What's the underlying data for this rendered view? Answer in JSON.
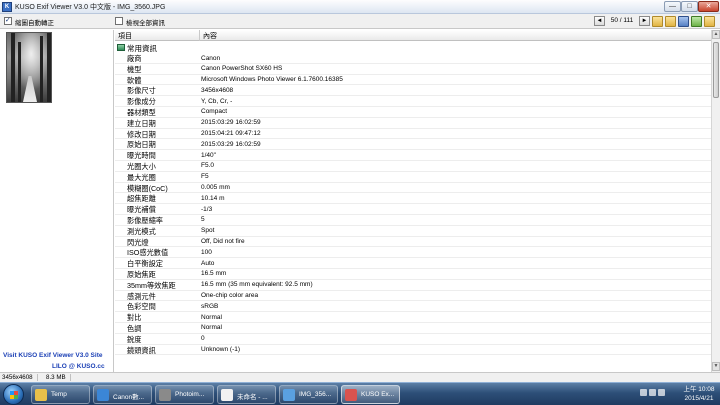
{
  "window": {
    "title": "KUSO Exif Viewer V3.0 中文版 - IMG_3560.JPG",
    "min_glyph": "—",
    "max_glyph": "□",
    "close_glyph": "✕"
  },
  "toolbar": {
    "auto_rotate_label": "縮圖自動轉正",
    "show_all_label": "檢視全部資訊",
    "prev_glyph": "◄",
    "next_glyph": "►",
    "page_count": "50 / 111"
  },
  "left": {
    "credit_line1": "Visit KUSO Exif Viewer V3.0 Site",
    "credit_line2": "LILO @ KUSO.cc"
  },
  "table": {
    "col_item": "項目",
    "col_content": "內容",
    "group_label": "常用資訊",
    "rows": [
      {
        "k": "廠商",
        "v": "Canon"
      },
      {
        "k": "機型",
        "v": "Canon PowerShot SX60 HS"
      },
      {
        "k": "軟體",
        "v": "Microsoft Windows Photo Viewer 6.1.7600.16385"
      },
      {
        "k": "影像尺寸",
        "v": "3456x4608"
      },
      {
        "k": "影像成分",
        "v": "Y, Cb, Cr, -"
      },
      {
        "k": "器材類型",
        "v": "Compact"
      },
      {
        "k": "建立日期",
        "v": "2015:03:29 16:02:59"
      },
      {
        "k": "修改日期",
        "v": "2015:04:21 09:47:12"
      },
      {
        "k": "原始日期",
        "v": "2015:03:29 16:02:59"
      },
      {
        "k": "曝光時間",
        "v": "1/40\""
      },
      {
        "k": "光圈大小",
        "v": "F5.0"
      },
      {
        "k": "最大光圈",
        "v": "F5"
      },
      {
        "k": "模糊圈(CoC)",
        "v": "0.005 mm"
      },
      {
        "k": "超焦距離",
        "v": "10.14 m"
      },
      {
        "k": "曝光補償",
        "v": "-1/3"
      },
      {
        "k": "影像壓縮率",
        "v": "5"
      },
      {
        "k": "測光模式",
        "v": "Spot"
      },
      {
        "k": "閃光燈",
        "v": "Off, Did not fire"
      },
      {
        "k": "ISO感光數值",
        "v": "100"
      },
      {
        "k": "白平衡設定",
        "v": "Auto"
      },
      {
        "k": "原始焦距",
        "v": "16.5 mm"
      },
      {
        "k": "35mm等效焦距",
        "v": "16.5 mm (35 mm equivalent: 92.5 mm)"
      },
      {
        "k": "感測元件",
        "v": "One-chip color area"
      },
      {
        "k": "色彩空間",
        "v": "sRGB"
      },
      {
        "k": "對比",
        "v": "Normal"
      },
      {
        "k": "色調",
        "v": "Normal"
      },
      {
        "k": "銳度",
        "v": "0"
      },
      {
        "k": "鏡頭資訊",
        "v": "Unknown (-1)"
      }
    ]
  },
  "scroll": {
    "up_glyph": "▲",
    "down_glyph": "▼"
  },
  "status": {
    "dimensions": "3456x4608",
    "size": "8.3 MB"
  },
  "taskbar": {
    "tasks": [
      {
        "label": "Temp",
        "color": "#e8c04a"
      },
      {
        "label": "Canon數...",
        "color": "#3b86d6"
      },
      {
        "label": "Photoim...",
        "color": "#8a8a8a"
      },
      {
        "label": "未命名 - ...",
        "color": "#f2f2f2"
      },
      {
        "label": "IMG_356...",
        "color": "#5aa0e0"
      },
      {
        "label": "KUSO Ex...",
        "color": "#d9534f"
      }
    ],
    "clock_time": "上午 10:08",
    "clock_date": "2015/4/21"
  }
}
